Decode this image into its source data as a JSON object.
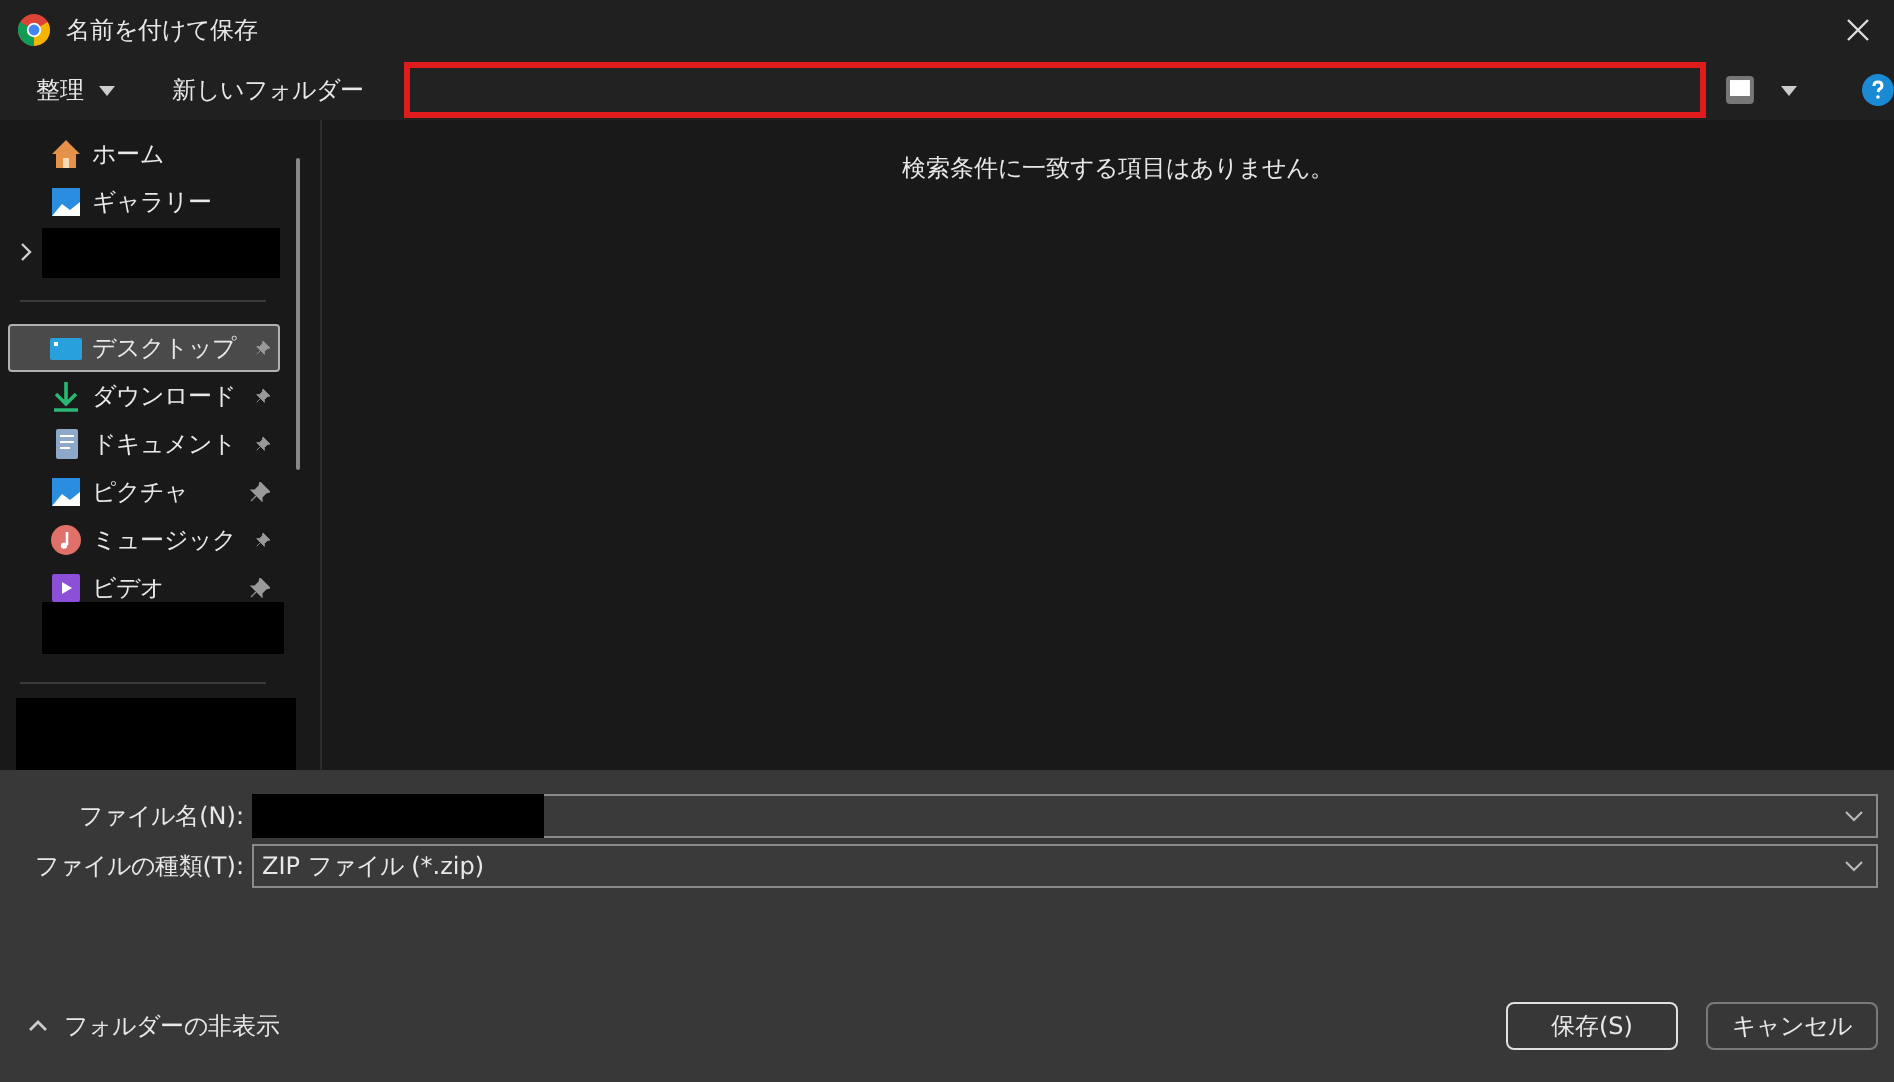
{
  "window": {
    "title": "名前を付けて保存"
  },
  "toolbar": {
    "organize": "整理",
    "new_folder": "新しいフォルダー"
  },
  "sidebar": {
    "top_items": [
      {
        "label": "ホーム"
      },
      {
        "label": "ギャラリー"
      }
    ],
    "pinned_items": [
      {
        "label": "デスクトップ",
        "selected": true,
        "pinned": true
      },
      {
        "label": "ダウンロード",
        "selected": false,
        "pinned": true
      },
      {
        "label": "ドキュメント",
        "selected": false,
        "pinned": true
      },
      {
        "label": "ピクチャ",
        "selected": false,
        "pinned": true
      },
      {
        "label": "ミュージック",
        "selected": false,
        "pinned": true
      },
      {
        "label": "ビデオ",
        "selected": false,
        "pinned": true
      }
    ]
  },
  "content": {
    "empty_message": "検索条件に一致する項目はありません。"
  },
  "form": {
    "file_name_label": "ファイル名(N):",
    "file_type_label": "ファイルの種類(T):",
    "file_type_value": "ZIP ファイル (*.zip)"
  },
  "hide_folders": "フォルダーの非表示",
  "buttons": [
    {
      "label": "保存(S)",
      "selected": true
    },
    {
      "label": "キャンセル",
      "selected": false
    }
  ]
}
